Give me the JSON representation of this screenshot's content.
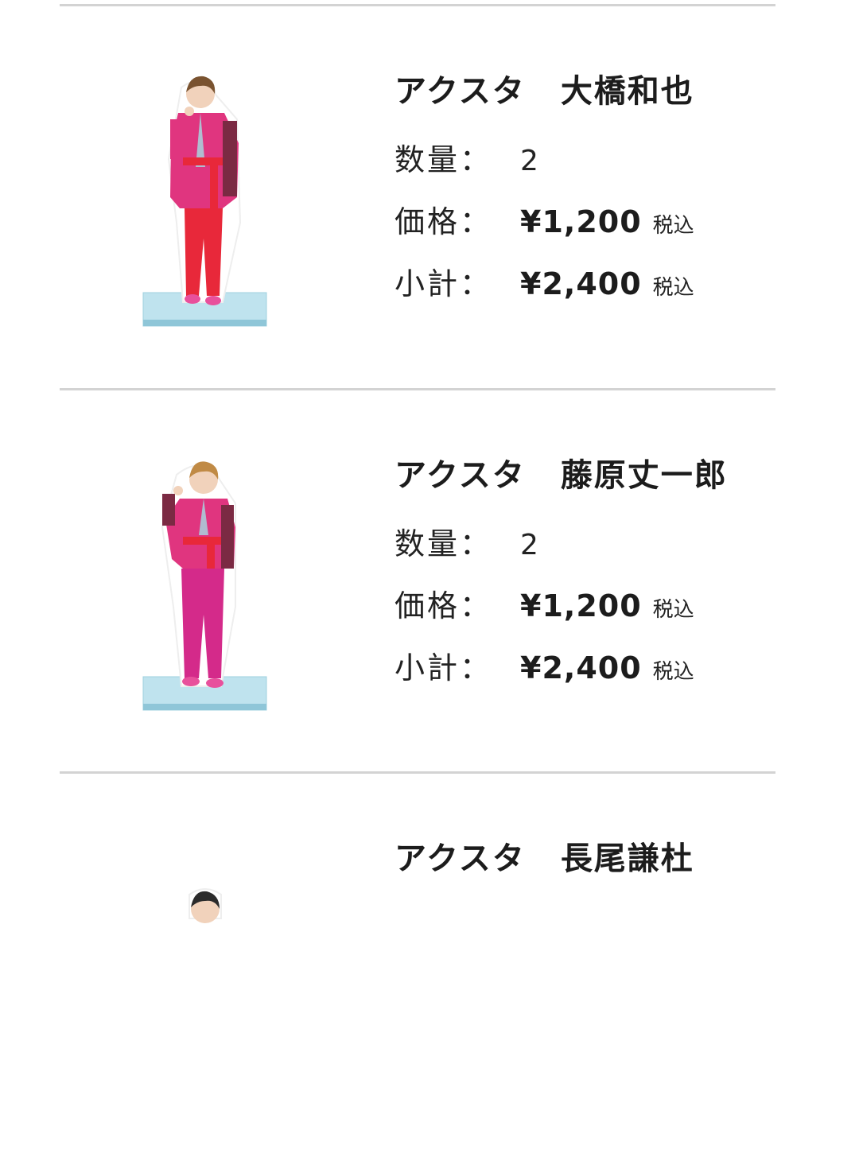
{
  "labels": {
    "quantity": "数量：",
    "price": "価格：",
    "subtotal": "小計：",
    "tax_included": "税込"
  },
  "items": [
    {
      "product": "アクスタ",
      "member": "大橋和也",
      "quantity": "2",
      "price": "¥1,200",
      "subtotal": "¥2,400",
      "image_icon": "acrylic-stand-figure-icon"
    },
    {
      "product": "アクスタ",
      "member": "藤原丈一郎",
      "quantity": "2",
      "price": "¥1,200",
      "subtotal": "¥2,400",
      "image_icon": "acrylic-stand-figure-icon"
    },
    {
      "product": "アクスタ",
      "member": "長尾謙杜"
    }
  ],
  "colors": {
    "divider": "#d3d3d3",
    "jacket": "#e0357f",
    "pants_item1": "#e8283a",
    "pants_item2": "#d42a8a",
    "stand_base": "#bfe3ee"
  }
}
